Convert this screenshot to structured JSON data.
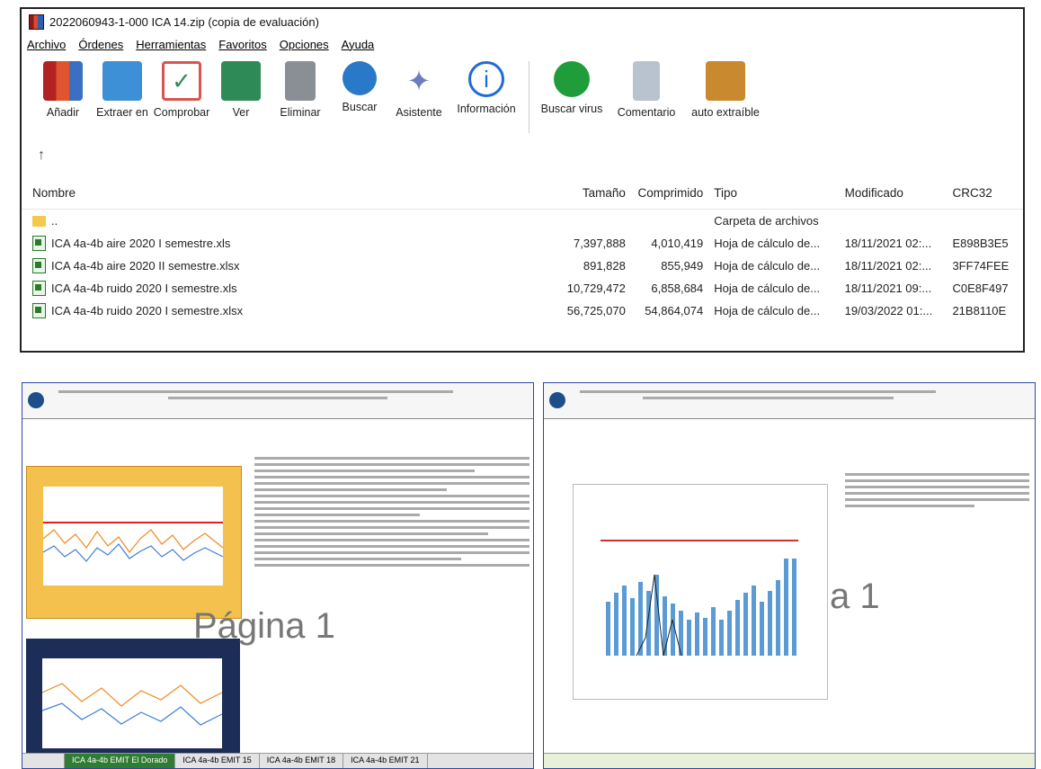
{
  "window": {
    "title": "2022060943-1-000 ICA 14.zip (copia de evaluación)"
  },
  "menu": [
    "Archivo",
    "Órdenes",
    "Herramientas",
    "Favoritos",
    "Opciones",
    "Ayuda"
  ],
  "toolbar": [
    {
      "label": "Añadir",
      "icon": "add-archive-icon",
      "color": "#b22222"
    },
    {
      "label": "Extraer en",
      "icon": "extract-folder-icon",
      "color": "#3d8fd6"
    },
    {
      "label": "Comprobar",
      "icon": "test-check-icon",
      "color": "#d9534f"
    },
    {
      "label": "Ver",
      "icon": "view-book-icon",
      "color": "#2e8b57"
    },
    {
      "label": "Eliminar",
      "icon": "trash-icon",
      "color": "#8a8f96"
    },
    {
      "label": "Buscar",
      "icon": "search-icon",
      "color": "#2a78c8"
    },
    {
      "label": "Asistente",
      "icon": "wizard-icon",
      "color": "#6b7dbf"
    },
    {
      "label": "Información",
      "icon": "info-icon",
      "color": "#1e6bd6"
    },
    {
      "label": "Buscar virus",
      "icon": "virus-scan-icon",
      "color": "#1f9d3a"
    },
    {
      "label": "Comentario",
      "icon": "comment-icon",
      "color": "#6d7d8e"
    },
    {
      "label": "auto extraíble",
      "icon": "sfx-box-icon",
      "color": "#c9892e"
    }
  ],
  "up_arrow": "↑",
  "columns": [
    "Nombre",
    "Tamaño",
    "Comprimido",
    "Tipo",
    "Modificado",
    "CRC32"
  ],
  "files": [
    {
      "name": "..",
      "size": "",
      "comp": "",
      "type": "Carpeta de archivos",
      "mod": "",
      "crc": "",
      "folder": true
    },
    {
      "name": "ICA 4a-4b aire 2020 I semestre.xls",
      "size": "7,397,888",
      "comp": "4,010,419",
      "type": "Hoja de cálculo de...",
      "mod": "18/11/2021 02:...",
      "crc": "E898B3E5"
    },
    {
      "name": "ICA 4a-4b aire 2020 II semestre.xlsx",
      "size": "891,828",
      "comp": "855,949",
      "type": "Hoja de cálculo de...",
      "mod": "18/11/2021 02:...",
      "crc": "3FF74FEE"
    },
    {
      "name": "ICA 4a-4b ruido 2020 I semestre.xls",
      "size": "10,729,472",
      "comp": "6,858,684",
      "type": "Hoja de cálculo de...",
      "mod": "18/11/2021 09:...",
      "crc": "C0E8F497"
    },
    {
      "name": "ICA 4a-4b ruido 2020 I semestre.xlsx",
      "size": "56,725,070",
      "comp": "54,864,074",
      "type": "Hoja de cálculo de...",
      "mod": "19/03/2022 01:...",
      "crc": "21B8110E"
    }
  ],
  "preview_left": {
    "watermark": "Página 1",
    "tabs": [
      "ICA 4a-4b EMIT El Dorado",
      "ICA 4a-4b EMIT 15",
      "ICA 4a-4b EMIT 18",
      "ICA 4a-4b EMIT 21"
    ]
  },
  "preview_right": {
    "watermark": "a 1"
  }
}
